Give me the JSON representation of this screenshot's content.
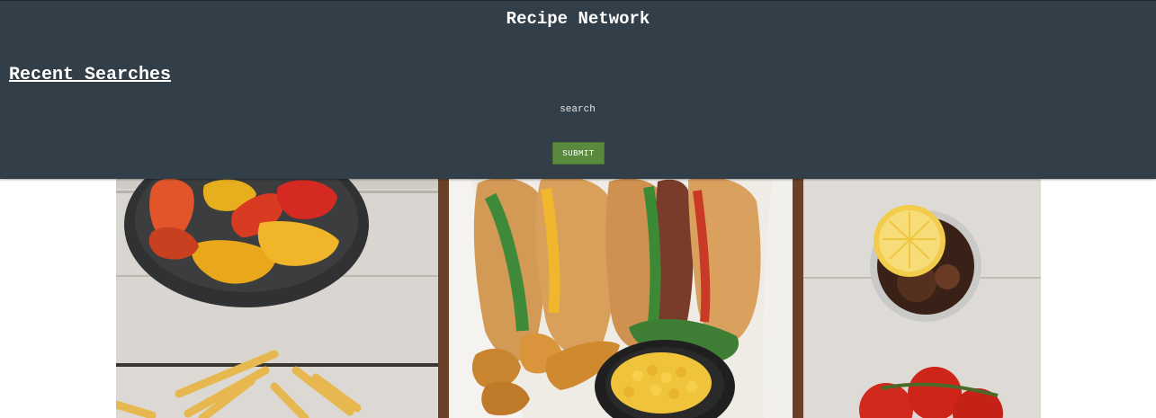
{
  "header": {
    "title": "Recipe Network",
    "recent_searches": "Recent Searches"
  },
  "search": {
    "placeholder": "search",
    "submit_label": "SUBMIT"
  },
  "hero": {
    "alt": "Food spread with grilled peppers, sandwiches, potato wedges, corn, fries, tomatoes and a cola with lemon"
  }
}
